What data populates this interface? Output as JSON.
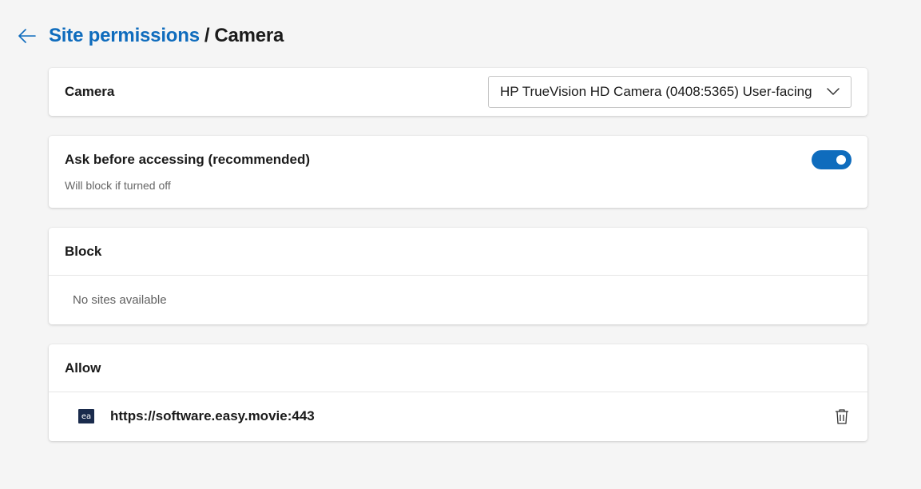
{
  "header": {
    "parent_label": "Site permissions",
    "separator": "/",
    "current_label": "Camera"
  },
  "camera": {
    "label": "Camera",
    "selected_device": "HP TrueVision HD Camera (0408:5365) User-facing"
  },
  "ask": {
    "label": "Ask before accessing (recommended)",
    "sublabel": "Will block if turned off",
    "toggle_on": true
  },
  "block": {
    "title": "Block",
    "empty_text": "No sites available"
  },
  "allow": {
    "title": "Allow",
    "sites": [
      {
        "url": "https://software.easy.movie:443",
        "favicon_text": "ea"
      }
    ]
  },
  "colors": {
    "accent": "#0f6cbd",
    "background": "#f5f5f5",
    "card": "#ffffff",
    "favicon_bg": "#1a2b4c"
  }
}
